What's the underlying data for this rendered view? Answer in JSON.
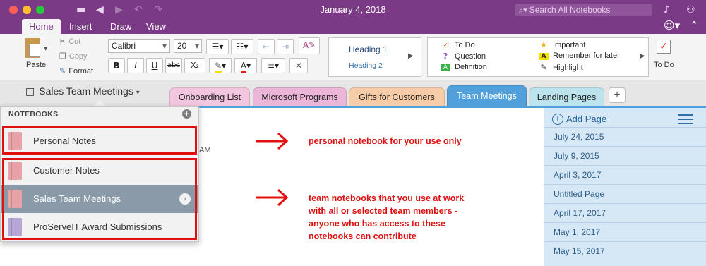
{
  "window": {
    "title": "January 4, 2018",
    "search_placeholder": "Search All Notebooks"
  },
  "ribbon_tabs": [
    "Home",
    "Insert",
    "Draw",
    "View"
  ],
  "ribbon": {
    "paste": "Paste",
    "cut": "Cut",
    "copy": "Copy",
    "format": "Format",
    "font_name": "Calibri",
    "font_size": "20",
    "bold": "B",
    "italic": "I",
    "underline": "U",
    "strike": "abc",
    "subscript": "X₂",
    "styles": [
      "Heading 1",
      "Heading 2"
    ],
    "tags": [
      {
        "label": "To Do",
        "icon": "checkbox-icon"
      },
      {
        "label": "Question",
        "icon": "question-icon"
      },
      {
        "label": "Definition",
        "icon": "definition-icon"
      },
      {
        "label": "Important",
        "icon": "star-icon"
      },
      {
        "label": "Remember for later",
        "icon": "highlight-a-icon"
      },
      {
        "label": "Highlight",
        "icon": "pen-icon"
      }
    ],
    "todo_tag": "To Do"
  },
  "notebook": {
    "current": "Sales Team Meetings"
  },
  "section_tabs": [
    {
      "label": "Onboarding List",
      "color": "#f3c6df"
    },
    {
      "label": "Microsoft Programs",
      "color": "#ecb6d8"
    },
    {
      "label": "Gifts for Customers",
      "color": "#f6cda8"
    },
    {
      "label": "Team Meetings",
      "color": "#52a0db"
    },
    {
      "label": "Landing Pages",
      "color": "#bde3ec"
    }
  ],
  "pages": {
    "add_label": "Add Page",
    "items": [
      "July 24, 2015",
      "July 9, 2015",
      "April 3, 2017",
      "Untitled Page",
      "April 17, 2017",
      "May 1, 2017",
      "May 15, 2017"
    ]
  },
  "notebooks_popup": {
    "header": "NOTEBOOKS",
    "items": [
      {
        "label": "Personal Notes",
        "color": "#e8a3a8"
      },
      {
        "label": "Customer Notes",
        "color": "#e8a3a8"
      },
      {
        "label": "Sales Team Meetings",
        "color": "#e8a3a8"
      },
      {
        "label": "ProServeIT Award Submissions",
        "color": "#b7a7d6"
      }
    ]
  },
  "page_fragment": "AM",
  "annotations": {
    "personal": "personal notebook for your use only",
    "team": [
      "team notebooks that you use at work",
      "with all or selected team members -",
      "anyone who has access to these",
      "notebooks can contribute"
    ],
    "color": "#e01010"
  }
}
